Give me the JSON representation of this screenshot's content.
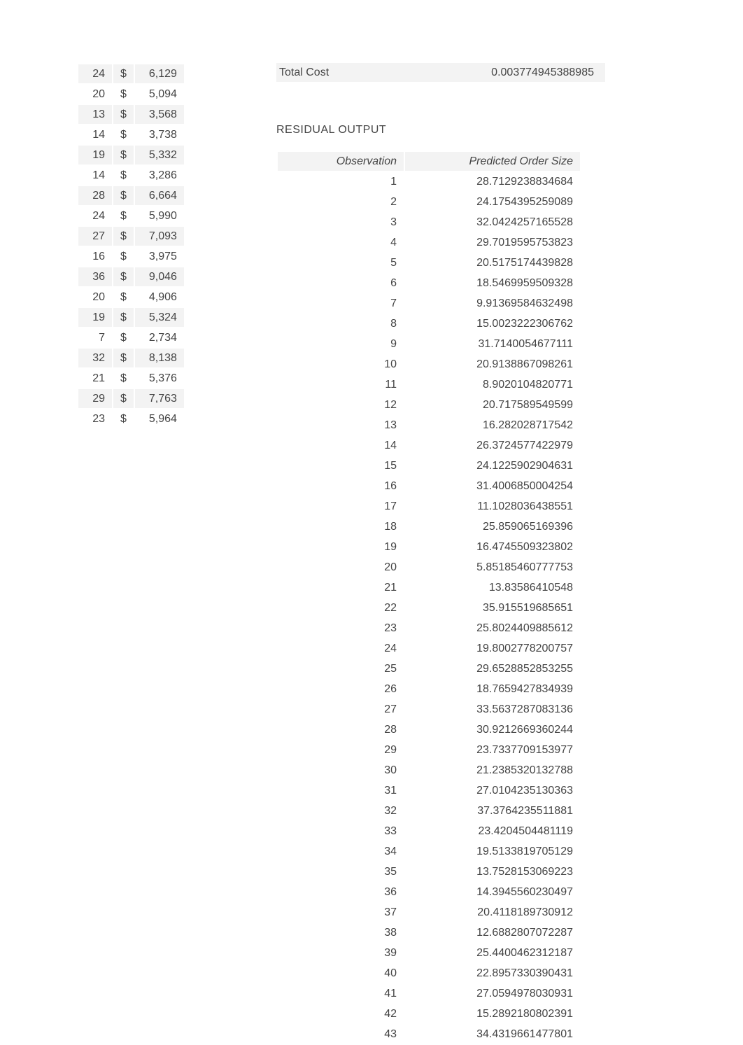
{
  "left_table": [
    {
      "a": "24",
      "b": "$",
      "c": "6,129"
    },
    {
      "a": "20",
      "b": "$",
      "c": "5,094"
    },
    {
      "a": "13",
      "b": "$",
      "c": "3,568"
    },
    {
      "a": "14",
      "b": "$",
      "c": "3,738"
    },
    {
      "a": "19",
      "b": "$",
      "c": "5,332"
    },
    {
      "a": "14",
      "b": "$",
      "c": "3,286"
    },
    {
      "a": "28",
      "b": "$",
      "c": "6,664"
    },
    {
      "a": "24",
      "b": "$",
      "c": "5,990"
    },
    {
      "a": "27",
      "b": "$",
      "c": "7,093"
    },
    {
      "a": "16",
      "b": "$",
      "c": "3,975"
    },
    {
      "a": "36",
      "b": "$",
      "c": "9,046"
    },
    {
      "a": "20",
      "b": "$",
      "c": "4,906"
    },
    {
      "a": "19",
      "b": "$",
      "c": "5,324"
    },
    {
      "a": "7",
      "b": "$",
      "c": "2,734"
    },
    {
      "a": "32",
      "b": "$",
      "c": "8,138"
    },
    {
      "a": "21",
      "b": "$",
      "c": "5,376"
    },
    {
      "a": "29",
      "b": "$",
      "c": "7,763"
    },
    {
      "a": "23",
      "b": "$",
      "c": "5,964"
    }
  ],
  "total_cost": {
    "label": "Total Cost",
    "value": "0.003774945388985"
  },
  "residual_title": "RESIDUAL OUTPUT",
  "residual_headers": {
    "observation": "Observation",
    "predicted": "Predicted Order Size"
  },
  "residual_data": [
    {
      "obs": "1",
      "pred": "28.7129238834684"
    },
    {
      "obs": "2",
      "pred": "24.1754395259089"
    },
    {
      "obs": "3",
      "pred": "32.0424257165528"
    },
    {
      "obs": "4",
      "pred": "29.7019595753823"
    },
    {
      "obs": "5",
      "pred": "20.5175174439828"
    },
    {
      "obs": "6",
      "pred": "18.5469959509328"
    },
    {
      "obs": "7",
      "pred": "9.91369584632498"
    },
    {
      "obs": "8",
      "pred": "15.0023222306762"
    },
    {
      "obs": "9",
      "pred": "31.7140054677111"
    },
    {
      "obs": "10",
      "pred": "20.9138867098261"
    },
    {
      "obs": "11",
      "pred": "8.9020104820771"
    },
    {
      "obs": "12",
      "pred": "20.717589549599"
    },
    {
      "obs": "13",
      "pred": "16.282028717542"
    },
    {
      "obs": "14",
      "pred": "26.3724577422979"
    },
    {
      "obs": "15",
      "pred": "24.1225902904631"
    },
    {
      "obs": "16",
      "pred": "31.4006850004254"
    },
    {
      "obs": "17",
      "pred": "11.1028036438551"
    },
    {
      "obs": "18",
      "pred": "25.859065169396"
    },
    {
      "obs": "19",
      "pred": "16.4745509323802"
    },
    {
      "obs": "20",
      "pred": "5.85185460777753"
    },
    {
      "obs": "21",
      "pred": "13.83586410548"
    },
    {
      "obs": "22",
      "pred": "35.915519685651"
    },
    {
      "obs": "23",
      "pred": "25.8024409885612"
    },
    {
      "obs": "24",
      "pred": "19.8002778200757"
    },
    {
      "obs": "25",
      "pred": "29.6528852853255"
    },
    {
      "obs": "26",
      "pred": "18.7659427834939"
    },
    {
      "obs": "27",
      "pred": "33.5637287083136"
    },
    {
      "obs": "28",
      "pred": "30.9212669360244"
    },
    {
      "obs": "29",
      "pred": "23.7337709153977"
    },
    {
      "obs": "30",
      "pred": "21.2385320132788"
    },
    {
      "obs": "31",
      "pred": "27.0104235130363"
    },
    {
      "obs": "32",
      "pred": "37.3764235511881"
    },
    {
      "obs": "33",
      "pred": "23.4204504481119"
    },
    {
      "obs": "34",
      "pred": "19.5133819705129"
    },
    {
      "obs": "35",
      "pred": "13.7528153069223"
    },
    {
      "obs": "36",
      "pred": "14.3945560230497"
    },
    {
      "obs": "37",
      "pred": "20.4118189730912"
    },
    {
      "obs": "38",
      "pred": "12.6882807072287"
    },
    {
      "obs": "39",
      "pred": "25.4400462312187"
    },
    {
      "obs": "40",
      "pred": "22.8957330390431"
    },
    {
      "obs": "41",
      "pred": "27.0594978030931"
    },
    {
      "obs": "42",
      "pred": "15.2892180802391"
    },
    {
      "obs": "43",
      "pred": "34.4319661477801"
    }
  ]
}
